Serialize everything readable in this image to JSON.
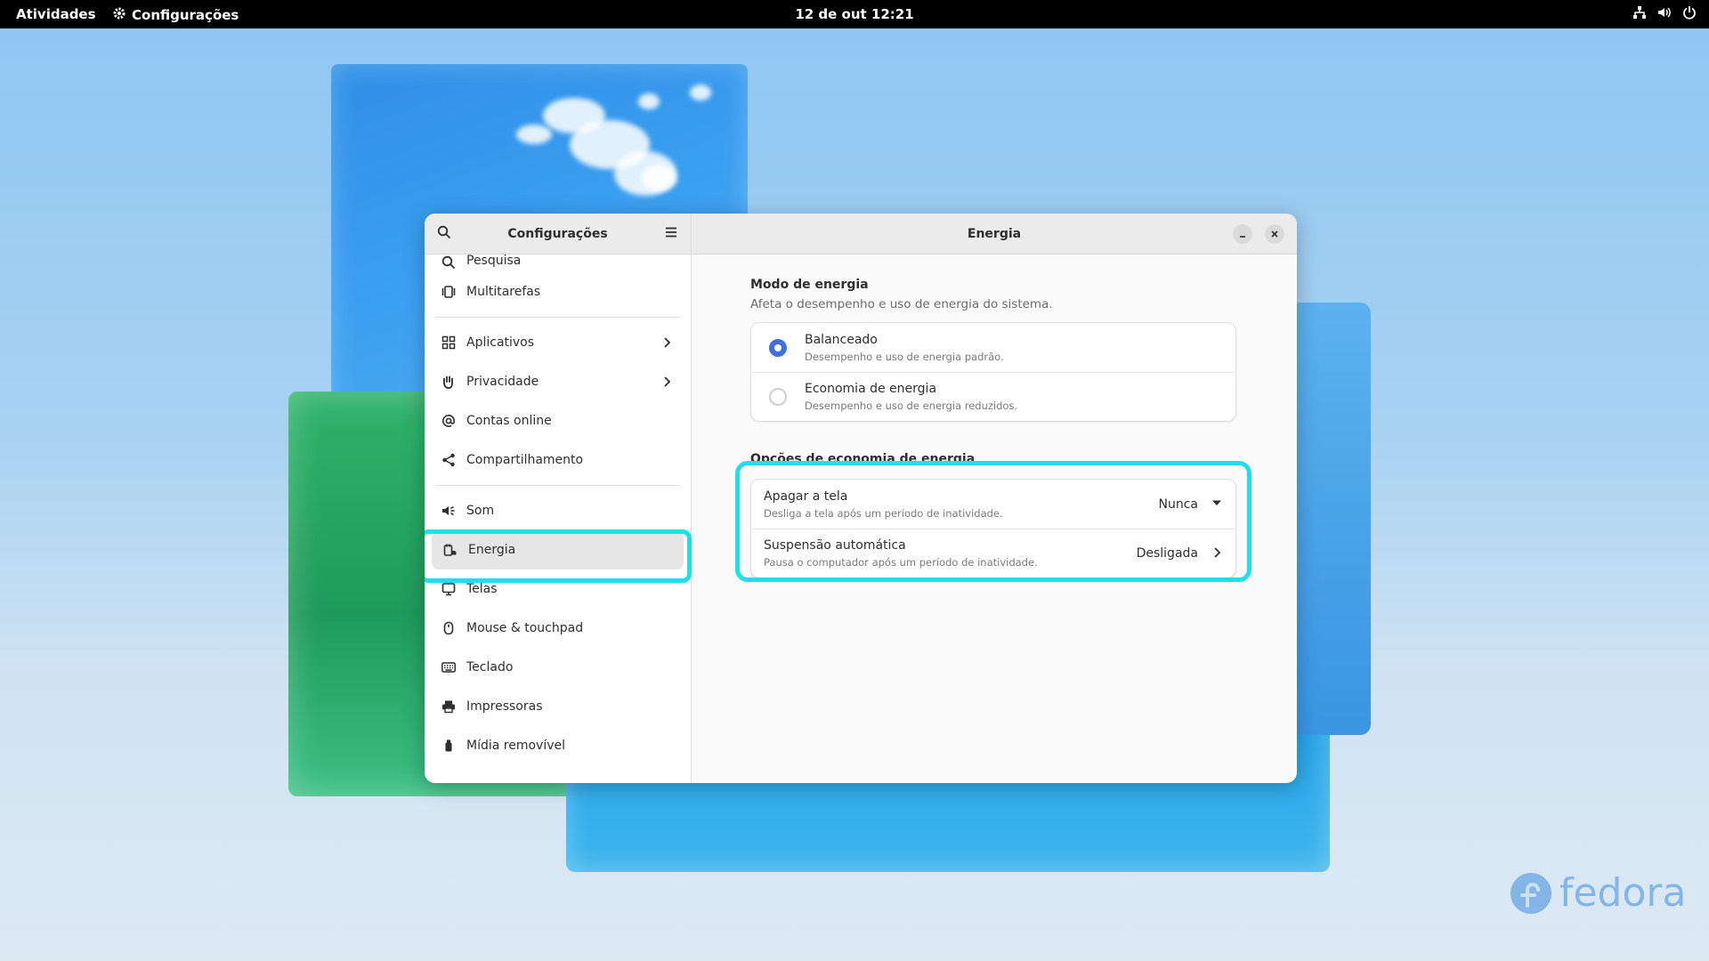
{
  "topbar": {
    "activities": "Atividades",
    "app_name": "Configurações",
    "clock": "12 de out  12:21"
  },
  "wallpaper": {
    "brand": "fedora"
  },
  "sidebar": {
    "title": "Configurações",
    "items": [
      {
        "label": "Pesquisa",
        "icon": "search-icon"
      },
      {
        "label": "Multitarefas",
        "icon": "multitasking-icon"
      },
      {
        "label": "Aplicativos",
        "icon": "apps-grid-icon"
      },
      {
        "label": "Privacidade",
        "icon": "hand-icon"
      },
      {
        "label": "Contas online",
        "icon": "at-icon"
      },
      {
        "label": "Compartilhamento",
        "icon": "share-icon"
      },
      {
        "label": "Som",
        "icon": "speaker-icon"
      },
      {
        "label": "Energia",
        "icon": "power-plug-icon"
      },
      {
        "label": "Telas",
        "icon": "monitor-icon"
      },
      {
        "label": "Mouse & touchpad",
        "icon": "mouse-icon"
      },
      {
        "label": "Teclado",
        "icon": "keyboard-icon"
      },
      {
        "label": "Impressoras",
        "icon": "printer-icon"
      },
      {
        "label": "Mídia removível",
        "icon": "usb-drive-icon"
      }
    ]
  },
  "content": {
    "title": "Energia",
    "power_mode": {
      "title": "Modo de energia",
      "description": "Afeta o desempenho e uso de energia do sistema.",
      "options": [
        {
          "title": "Balanceado",
          "subtitle": "Desempenho e uso de energia padrão.",
          "selected": true
        },
        {
          "title": "Economia de energia",
          "subtitle": "Desempenho e uso de energia reduzidos.",
          "selected": false
        }
      ]
    },
    "saving_options": {
      "title": "Opções de economia de energia",
      "rows": [
        {
          "title": "Apagar a tela",
          "subtitle": "Desliga a tela após um período de inatividade.",
          "value": "Nunca"
        },
        {
          "title": "Suspensão automática",
          "subtitle": "Pausa o computador após um período de inatividade.",
          "value": "Desligada"
        }
      ]
    }
  },
  "colors": {
    "accent": "#3f6fe0",
    "highlight": "#1fe0ea"
  }
}
